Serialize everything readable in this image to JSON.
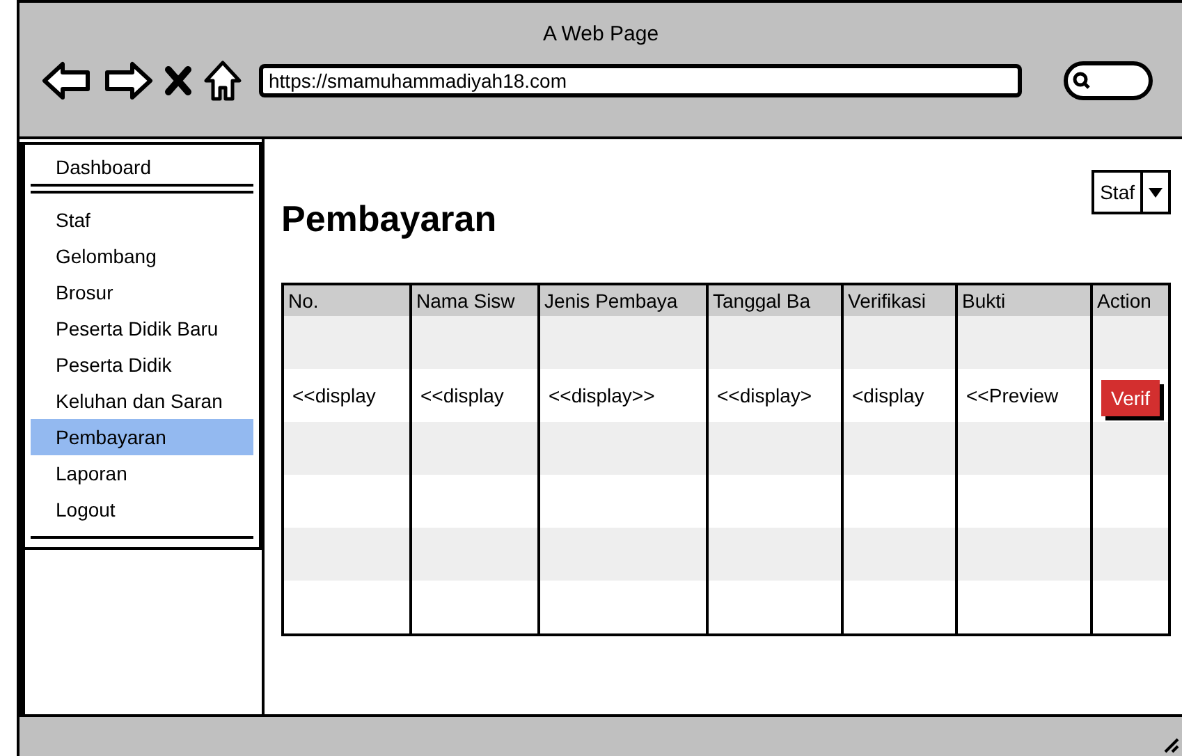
{
  "window": {
    "title": "A Web Page"
  },
  "browser": {
    "url": "https://smamuhammadiyah18.com"
  },
  "sidebar": {
    "header": {
      "label": "Dashboard",
      "selected": false
    },
    "items": [
      {
        "label": "Staf",
        "selected": false
      },
      {
        "label": "Gelombang",
        "selected": false
      },
      {
        "label": "Brosur",
        "selected": false
      },
      {
        "label": "Peserta Didik Baru",
        "selected": false
      },
      {
        "label": "Peserta Didik",
        "selected": false
      },
      {
        "label": "Keluhan dan Saran",
        "selected": false
      },
      {
        "label": "Pembayaran",
        "selected": true
      },
      {
        "label": "Laporan",
        "selected": false
      },
      {
        "label": "Logout",
        "selected": false
      }
    ]
  },
  "page": {
    "title": "Pembayaran",
    "role_dropdown": {
      "value": "Staf"
    }
  },
  "table": {
    "columns": [
      "No.",
      "Nama Sisw",
      "Jenis Pembaya",
      "Tanggal Ba",
      "Verifikasi",
      "Bukti",
      "Action"
    ],
    "rows": [
      {
        "cells": [
          "<<display",
          "<<display",
          "<<display>>",
          "<<display>",
          "<display",
          "<<Preview"
        ],
        "action": "Verif"
      }
    ]
  }
}
